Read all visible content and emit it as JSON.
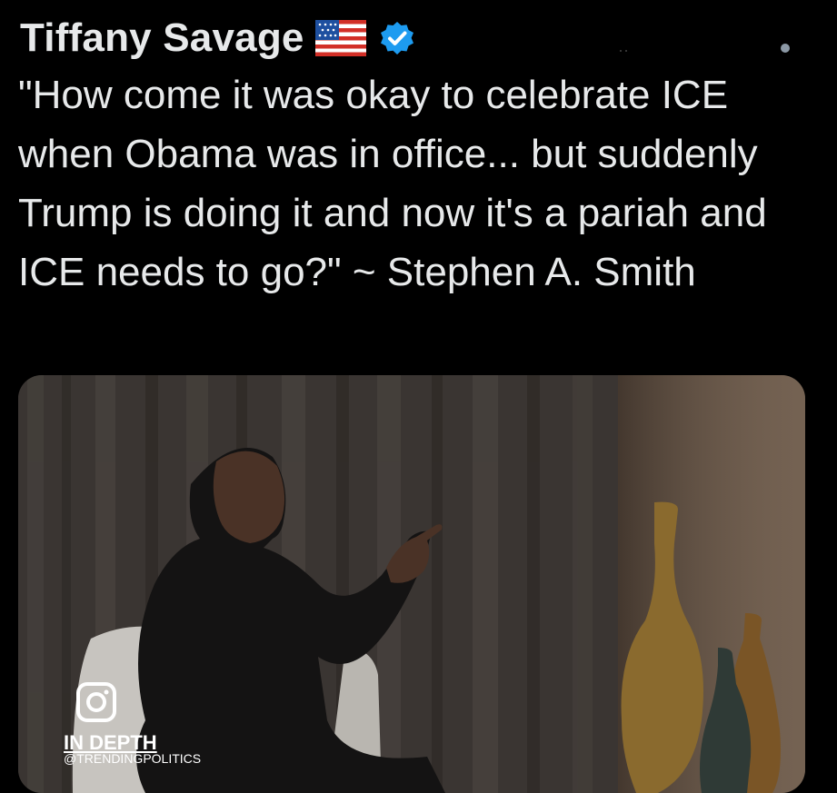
{
  "tweet": {
    "author_name": "Tiffany Savage",
    "flag_icon": "us-flag-icon",
    "verified_icon": "verified-badge-icon",
    "more_icon": "more-options-icon",
    "text": "\"How come it was okay to celebrate ICE when Obama was in office... but suddenly Trump is doing it and now it's a pariah and ICE needs to go?\" ~ Stephen A. Smith"
  },
  "media": {
    "type": "video",
    "watermark_line1": "IN DEPTH",
    "watermark_line2": "@TRENDINGPOLITICS",
    "watermark_icon": "instagram-icon"
  },
  "colors": {
    "background": "#000000",
    "text": "#e7e9ea",
    "verified": "#1d9bf0"
  }
}
